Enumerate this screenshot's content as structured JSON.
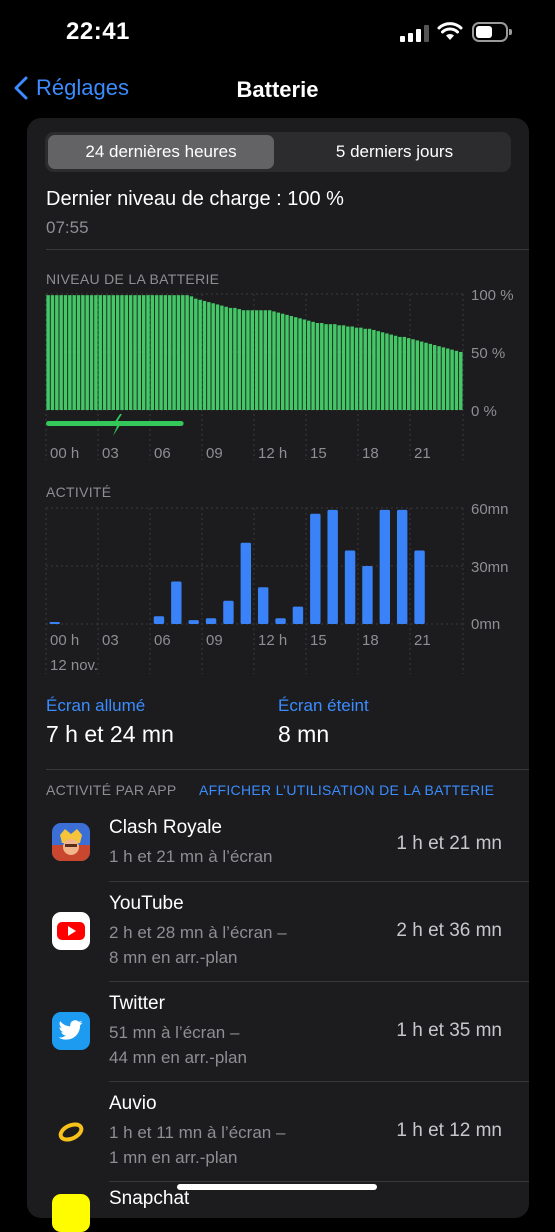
{
  "status_bar": {
    "time": "22:41"
  },
  "nav": {
    "back_label": "Réglages",
    "title": "Batterie"
  },
  "segmented": {
    "options": [
      "24 dernières heures",
      "5 derniers jours"
    ],
    "selected": 0
  },
  "last_charge": {
    "label": "Dernier niveau de charge : 100 %",
    "time": "07:55"
  },
  "battery_chart": {
    "section_label": "NIVEAU DE LA BATTERIE",
    "y_labels": [
      "100 %",
      "50 %",
      "0 %"
    ],
    "x_labels": [
      "00 h",
      "03",
      "06",
      "09",
      "12 h",
      "15",
      "18",
      "21"
    ],
    "charging_color": "#34c759"
  },
  "activity_chart": {
    "section_label": "ACTIVITÉ",
    "y_labels": [
      "60mn",
      "30mn",
      "0mn"
    ],
    "x_labels": [
      "00 h",
      "03",
      "06",
      "09",
      "12 h",
      "15",
      "18",
      "21"
    ],
    "date_label": "12 nov.",
    "bar_color": "#3a82f7"
  },
  "chart_data": [
    {
      "type": "bar",
      "title": "NIVEAU DE LA BATTERIE",
      "xlabel": "",
      "ylabel": "",
      "unit": "%",
      "ylim": [
        0,
        100
      ],
      "x_start_hour": 0,
      "hours_per_bar": 0.25,
      "values": [
        99,
        99,
        99,
        99,
        99,
        99,
        99,
        99,
        99,
        99,
        99,
        99,
        99,
        99,
        99,
        99,
        99,
        99,
        99,
        99,
        99,
        99,
        99,
        99,
        99,
        99,
        99,
        99,
        99,
        99,
        99,
        99,
        99,
        98,
        96,
        95,
        94,
        93,
        92,
        91,
        90,
        89,
        88,
        88,
        87,
        86,
        86,
        86,
        86,
        86,
        86,
        86,
        85,
        84,
        83,
        82,
        81,
        80,
        79,
        78,
        77,
        76,
        75,
        75,
        74,
        74,
        74,
        73,
        73,
        72,
        72,
        71,
        71,
        70,
        70,
        69,
        68,
        67,
        66,
        65,
        64,
        63,
        63,
        62,
        61,
        60,
        59,
        58,
        57,
        56,
        55,
        54,
        53,
        52,
        51,
        50
      ],
      "charging_period_hours": [
        0,
        7.92
      ]
    },
    {
      "type": "bar",
      "title": "ACTIVITÉ",
      "xlabel": "12 nov.",
      "ylabel": "",
      "unit": "mn",
      "ylim": [
        0,
        60
      ],
      "categories": [
        "00",
        "01",
        "02",
        "03",
        "04",
        "05",
        "06",
        "07",
        "08",
        "09",
        "10",
        "11",
        "12",
        "13",
        "14",
        "15",
        "16",
        "17",
        "18",
        "19",
        "20",
        "21",
        "22",
        "23"
      ],
      "values": [
        1,
        0,
        0,
        0,
        0,
        0,
        4,
        22,
        2,
        3,
        12,
        42,
        19,
        3,
        9,
        57,
        59,
        38,
        30,
        59,
        59,
        38,
        0,
        0
      ]
    }
  ],
  "screen": {
    "on_label": "Écran allumé",
    "on_value": "7 h et 24 mn",
    "off_label": "Écran éteint",
    "off_value": "8 mn"
  },
  "apps_section": {
    "title": "ACTIVITÉ PAR APP",
    "link": "AFFICHER L’UTILISATION DE LA BATTERIE"
  },
  "apps": [
    {
      "name": "Clash Royale",
      "detail1": "1 h et 21 mn à l’écran",
      "detail2": "",
      "total": "1 h et 21 mn",
      "icon": "clash-royale-icon"
    },
    {
      "name": "YouTube",
      "detail1": "2 h et 28 mn à l’écran –",
      "detail2": "8 mn en arr.-plan",
      "total": "2 h et 36 mn",
      "icon": "youtube-icon"
    },
    {
      "name": "Twitter",
      "detail1": "51 mn à l’écran –",
      "detail2": "44 mn en arr.-plan",
      "total": "1 h et 35 mn",
      "icon": "twitter-icon"
    },
    {
      "name": "Auvio",
      "detail1": "1 h et 11 mn à l’écran –",
      "detail2": "1 mn en arr.-plan",
      "total": "1 h et 12 mn",
      "icon": "auvio-icon"
    },
    {
      "name": "Snapchat",
      "detail1": "",
      "detail2": "",
      "total": "",
      "icon": "snapchat-icon"
    }
  ]
}
